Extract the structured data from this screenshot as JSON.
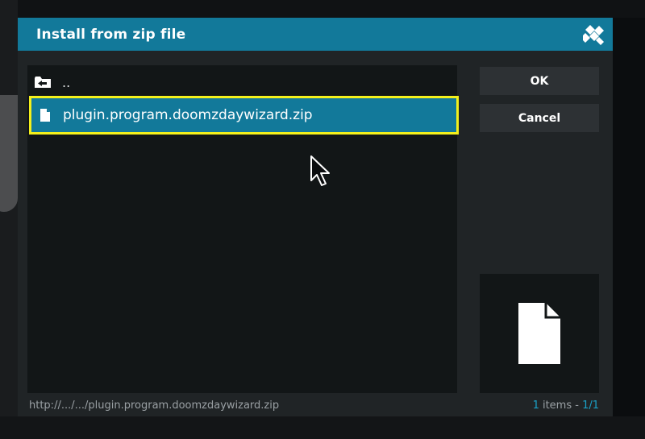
{
  "dialog": {
    "title": "Install from zip file",
    "logo_icon": "kodi-logo-icon"
  },
  "file_list": {
    "items": [
      {
        "label": "..",
        "icon": "parent-folder-icon",
        "selected": false
      },
      {
        "label": "plugin.program.doomzdaywizard.zip",
        "icon": "file-icon",
        "selected": true
      }
    ]
  },
  "buttons": {
    "ok_label": "OK",
    "cancel_label": "Cancel"
  },
  "preview": {
    "icon": "file-icon"
  },
  "footer": {
    "path": "http://.../.../plugin.program.doomzdaywizard.zip",
    "item_count": "1",
    "items_word": " items - ",
    "page": "1/1"
  },
  "colors": {
    "accent": "#12799a",
    "focus_border": "#f4f01c",
    "highlight_text": "#1aa1c8"
  }
}
